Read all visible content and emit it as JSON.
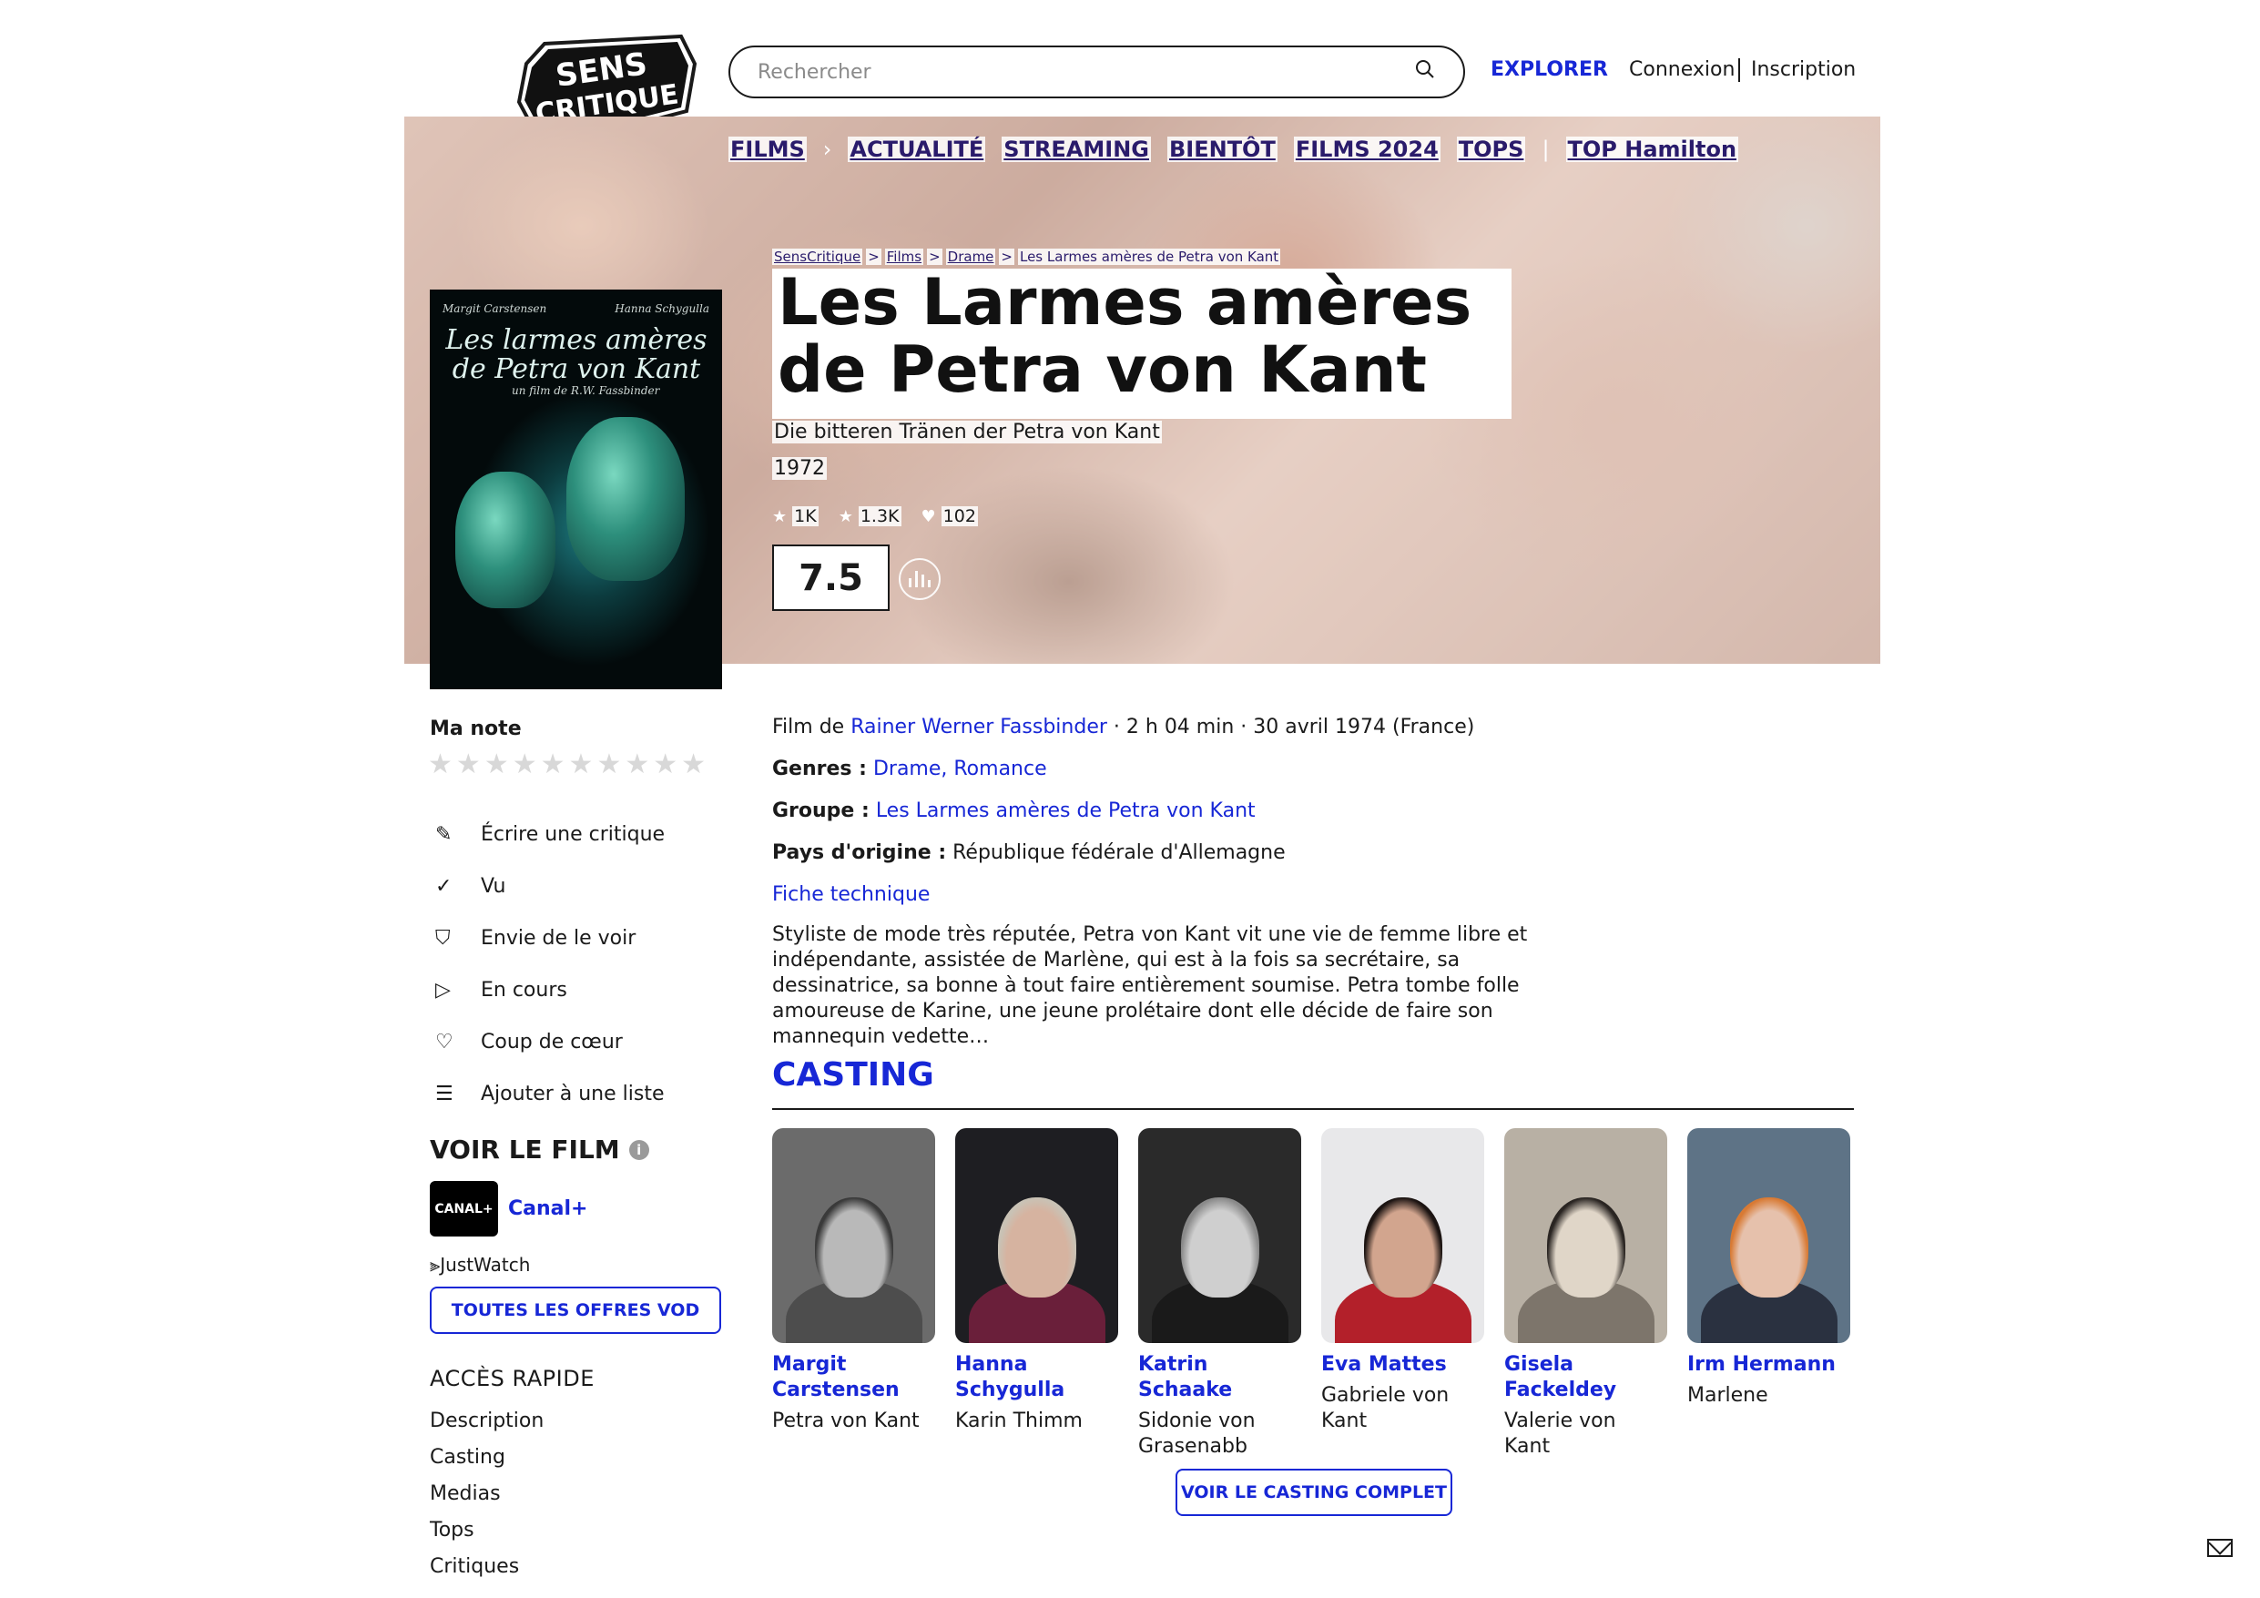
{
  "header": {
    "logo_text": "SENS CRITIQUE",
    "search_placeholder": "Rechercher",
    "explorer": "EXPLORER",
    "connexion": "Connexion",
    "inscription": "Inscription"
  },
  "nav": {
    "films": "FILMS",
    "arrow": "›",
    "items": [
      "ACTUALITÉ",
      "STREAMING",
      "BIENTÔT",
      "FILMS 2024",
      "TOPS"
    ],
    "divider": "|",
    "top_hamilton": "TOP Hamilton"
  },
  "breadcrumb": [
    "SensCritique",
    "Films",
    "Drame",
    "Les Larmes amères de Petra von Kant"
  ],
  "breadcrumb_sep": ">",
  "film": {
    "title": "Les Larmes amères de Petra von Kant",
    "original_title": "Die bitteren Tränen der Petra von Kant",
    "year": "1972",
    "stats": {
      "ratings": "1K",
      "wishlist": "1.3K",
      "favorites": "102"
    },
    "rating": "7.5"
  },
  "poster": {
    "actor_left": "Margit Carstensen",
    "actor_right": "Hanna Schygulla",
    "title": "Les larmes amères de Petra von Kant",
    "director_line": "un film de R.W. Fassbinder"
  },
  "sidebar": {
    "ma_note": "Ma note",
    "star_count": 10,
    "actions": [
      {
        "icon": "pencil-icon",
        "glyph": "✎",
        "label": "Écrire une critique"
      },
      {
        "icon": "check-icon",
        "glyph": "✓",
        "label": "Vu"
      },
      {
        "icon": "bookmark-icon",
        "glyph": "⛉",
        "label": "Envie de le voir"
      },
      {
        "icon": "play-icon",
        "glyph": "▷",
        "label": "En cours"
      },
      {
        "icon": "heart-icon",
        "glyph": "♡",
        "label": "Coup de cœur"
      },
      {
        "icon": "list-add-icon",
        "glyph": "☰",
        "label": "Ajouter à une liste"
      }
    ],
    "voir_le_film": "VOIR LE FILM",
    "info_glyph": "i",
    "provider_logo": "CANAL+",
    "provider_name": "Canal+",
    "justwatch": "JustWatch",
    "vod_button": "TOUTES LES OFFRES VOD",
    "acces_rapide": "ACCÈS RAPIDE",
    "acces_items": [
      "Description",
      "Casting",
      "Medias",
      "Tops",
      "Critiques"
    ]
  },
  "details": {
    "film_de_label": "Film de",
    "director": "Rainer Werner Fassbinder",
    "meta": " · 2 h 04 min · 30 avril 1974 (France)",
    "genres_label": "Genres :",
    "genres": "Drame, Romance",
    "groupe_label": "Groupe :",
    "groupe": "Les Larmes amères de Petra von Kant",
    "pays_label": "Pays d'origine :",
    "pays": "République fédérale d'Allemagne",
    "fiche": "Fiche technique",
    "synopsis": "Styliste de mode très réputée, Petra von Kant vit une vie de femme libre et indépendante, assistée de Marlène, qui est à la fois sa secrétaire, sa dessinatrice, sa bonne à tout faire entièrement soumise. Petra tombe folle amoureuse de Karine, une jeune prolétaire dont elle décide de faire son mannequin vedette…"
  },
  "casting": {
    "heading": "CASTING",
    "actors": [
      {
        "name": "Margit Carstensen",
        "role": "Petra von Kant",
        "bg": "#6b6b6b",
        "skin": "#b9b9b9",
        "hair": "#3a3a3a",
        "cloth": "#4d4d4d"
      },
      {
        "name": "Hanna Schygulla",
        "role": "Karin Thimm",
        "bg": "#1e1e22",
        "skin": "#d6b3a0",
        "hair": "#c9c2b5",
        "cloth": "#6a1f3a"
      },
      {
        "name": "Katrin Schaake",
        "role": "Sidonie von Grasenabb",
        "bg": "#2a2a2a",
        "skin": "#cfcfcf",
        "hair": "#8a8a8a",
        "cloth": "#1a1a1a"
      },
      {
        "name": "Eva Mattes",
        "role": "Gabriele von Kant",
        "bg": "#e8e8ea",
        "skin": "#d2a58e",
        "hair": "#1c1412",
        "cloth": "#b3202a"
      },
      {
        "name": "Gisela Fackeldey",
        "role": "Valerie von Kant",
        "bg": "#b8b0a4",
        "skin": "#e0d6c8",
        "hair": "#2a2522",
        "cloth": "#7d756b"
      },
      {
        "name": "Irm Hermann",
        "role": "Marlene",
        "bg": "#5e7386",
        "skin": "#e6c1ac",
        "hair": "#d87a34",
        "cloth": "#2a3140"
      }
    ],
    "full_button": "VOIR LE CASTING COMPLET"
  }
}
